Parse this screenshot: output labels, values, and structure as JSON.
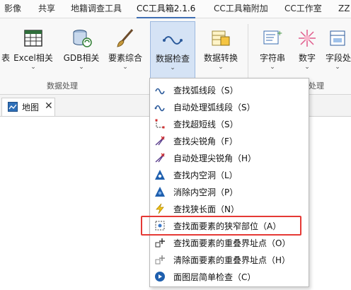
{
  "tabs": [
    "影像",
    "共享",
    "地籍调查工具",
    "CC工具箱2.1.6",
    "CC工具箱附加",
    "CC工作室",
    "ZZ"
  ],
  "ribbon": {
    "buttons": [
      {
        "label": "Excel相关",
        "icon": "table-icon"
      },
      {
        "label": "GDB相关",
        "icon": "database-sync-icon"
      },
      {
        "label": "要素综合",
        "icon": "brush-icon"
      },
      {
        "label": "数据检查",
        "icon": "wave-check-icon"
      },
      {
        "label": "数据转换",
        "icon": "table-convert-icon"
      },
      {
        "label": "字符串",
        "icon": "text-edit-icon"
      },
      {
        "label": "数字",
        "icon": "number-spark-icon"
      },
      {
        "label": "字段处",
        "icon": "field-icon"
      }
    ],
    "group_labels": [
      "数据处理",
      "处理"
    ],
    "dropdown_indicator": "⌄"
  },
  "map_tab": {
    "label": "地图",
    "close": "✕"
  },
  "menu": {
    "items": [
      {
        "label": "查找弧线段（S）",
        "icon": "arc-icon"
      },
      {
        "label": "自动处理弧线段（S）",
        "icon": "arc-fix-icon"
      },
      {
        "label": "查找超短线（S）",
        "icon": "short-line-icon"
      },
      {
        "label": "查找尖锐角（F）",
        "icon": "sharp-angle-icon"
      },
      {
        "label": "自动处理尖锐角（H）",
        "icon": "sharp-angle-fix-icon"
      },
      {
        "label": "查找内空洞（L）",
        "icon": "triangle-hole-icon"
      },
      {
        "label": "消除内空洞（P）",
        "icon": "triangle-fill-icon"
      },
      {
        "label": "查找狭长面（N）",
        "icon": "lightning-icon"
      },
      {
        "label": "查找面要素的狭窄部位（A）",
        "icon": "narrow-part-icon"
      },
      {
        "label": "查找面要素的重叠界址点（O）",
        "icon": "overlap-point-icon"
      },
      {
        "label": "清除面要素的重叠界址点（H）",
        "icon": "overlap-clear-icon"
      },
      {
        "label": "面图层简单检查（C）",
        "icon": "layer-check-icon"
      }
    ]
  },
  "colors": {
    "accent": "#3f6fb4",
    "highlight_box": "#e53935",
    "pressed": "#d5e3f5"
  }
}
